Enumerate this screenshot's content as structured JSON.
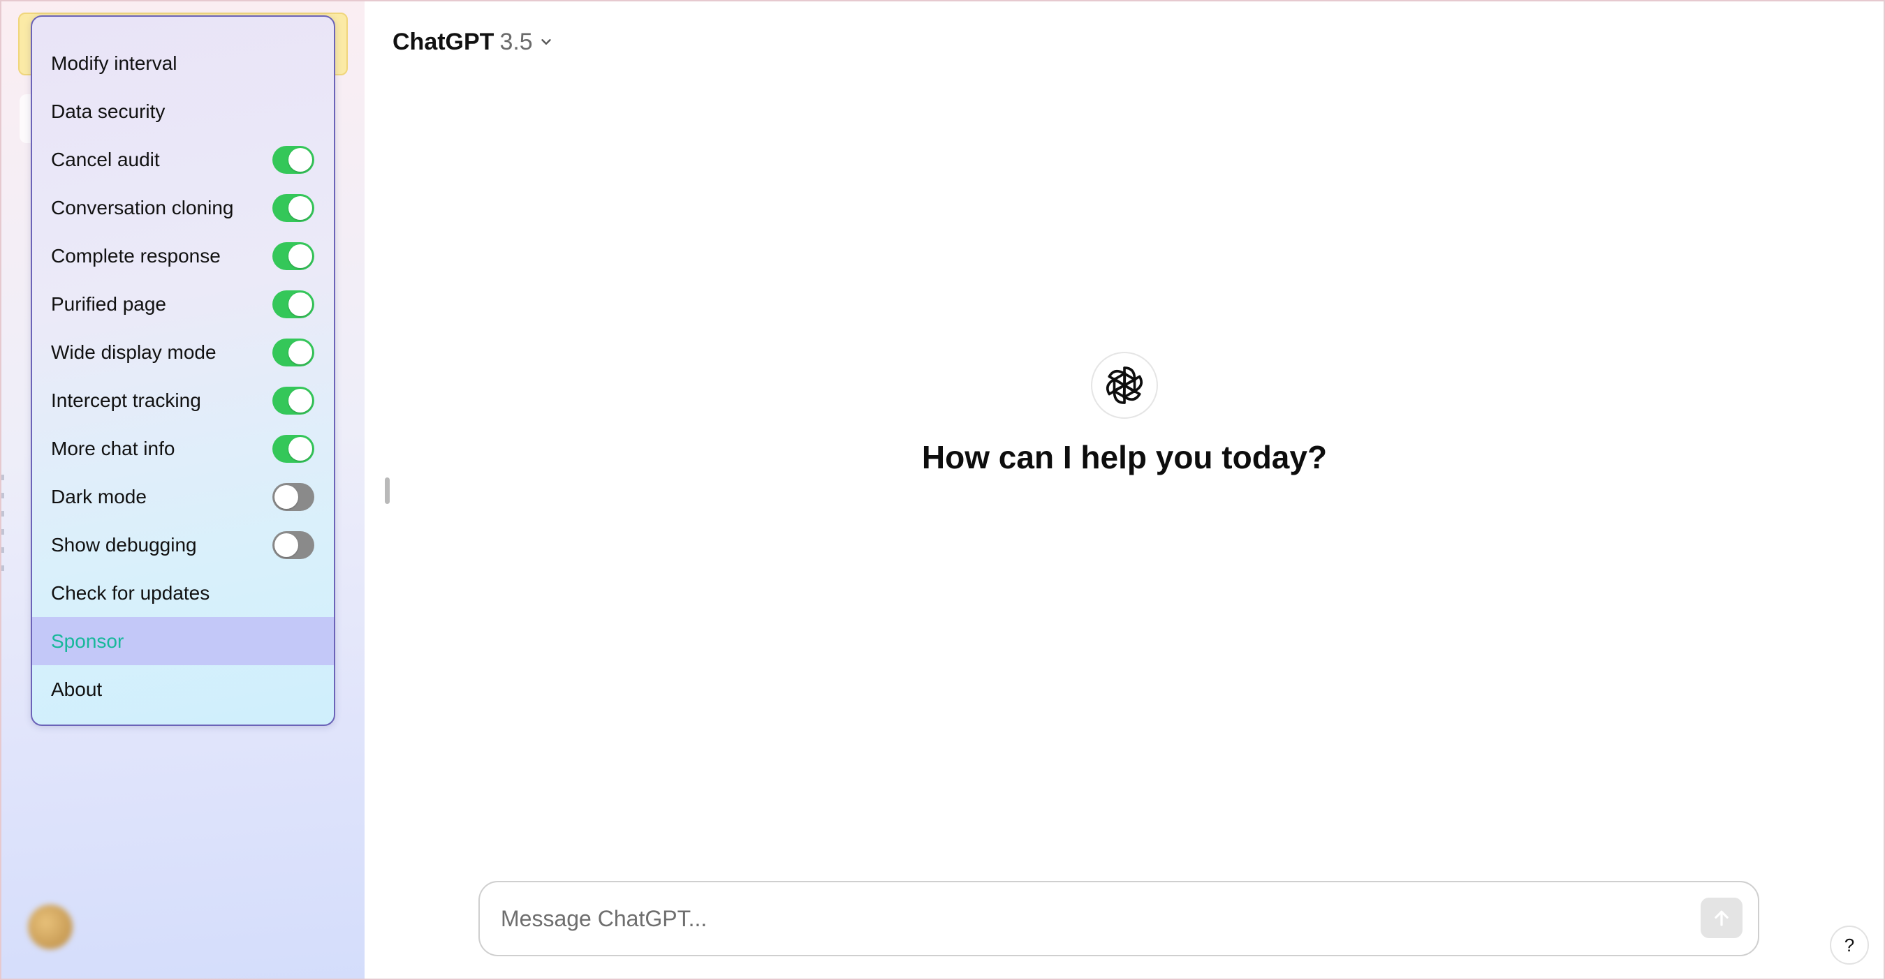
{
  "header": {
    "model_name": "ChatGPT",
    "model_version": "3.5",
    "dropdown_icon": "chevron-down-icon"
  },
  "menu": {
    "items": [
      {
        "label": "Modify interval"
      },
      {
        "label": "Data security"
      },
      {
        "label": "Cancel audit",
        "toggle": "on"
      },
      {
        "label": "Conversation cloning",
        "toggle": "on"
      },
      {
        "label": "Complete response",
        "toggle": "on"
      },
      {
        "label": "Purified page",
        "toggle": "on"
      },
      {
        "label": "Wide display mode",
        "toggle": "on"
      },
      {
        "label": "Intercept tracking",
        "toggle": "on"
      },
      {
        "label": "More chat info",
        "toggle": "on"
      },
      {
        "label": "Dark mode",
        "toggle": "off"
      },
      {
        "label": "Show debugging",
        "toggle": "off"
      },
      {
        "label": "Check for updates"
      },
      {
        "label": "Sponsor",
        "highlighted": true
      },
      {
        "label": "About"
      }
    ]
  },
  "main": {
    "logo_icon": "openai-logo-icon",
    "headline": "How can I help you today?"
  },
  "composer": {
    "value": "",
    "placeholder": "Message ChatGPT...",
    "send_icon": "arrow-up-icon"
  },
  "help": {
    "label": "?"
  },
  "colors": {
    "toggle_on": "#34c759",
    "toggle_off": "#8a8a8a",
    "highlight_bg": "#c3c8f8",
    "highlight_text": "#17b89a",
    "menu_border": "#6b63b8"
  }
}
